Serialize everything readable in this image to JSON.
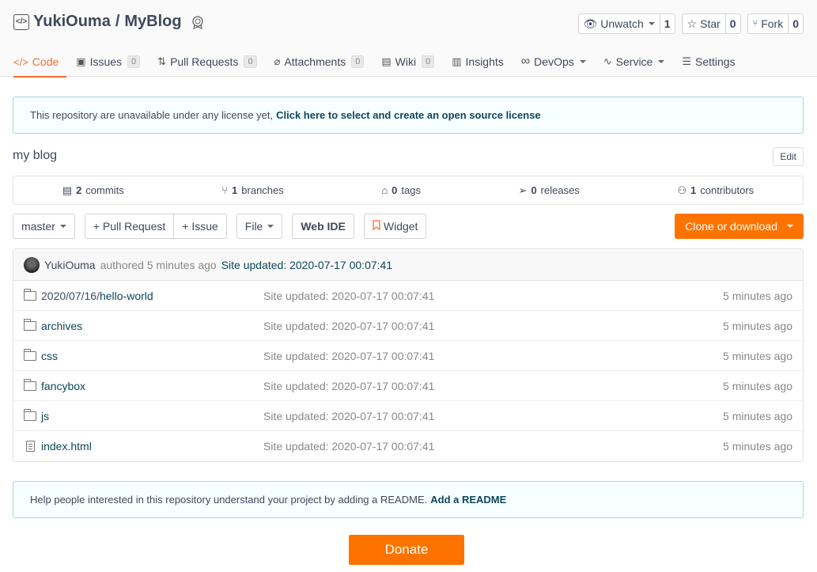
{
  "repo": {
    "owner": "YukiOuma",
    "separator": "/",
    "name": "MyBlog"
  },
  "actions": {
    "watch": {
      "label": "Unwatch",
      "count": "1"
    },
    "star": {
      "label": "Star",
      "count": "0"
    },
    "fork": {
      "label": "Fork",
      "count": "0"
    }
  },
  "tabs": [
    {
      "label": "Code",
      "icon": "code-icon"
    },
    {
      "label": "Issues",
      "count": "0",
      "icon": "issues-icon"
    },
    {
      "label": "Pull Requests",
      "count": "0",
      "icon": "pull-request-icon"
    },
    {
      "label": "Attachments",
      "count": "0",
      "icon": "paperclip-icon"
    },
    {
      "label": "Wiki",
      "count": "0",
      "icon": "wiki-icon"
    },
    {
      "label": "Insights",
      "icon": "bar-chart-icon"
    },
    {
      "label": "DevOps",
      "icon": "infinity-icon"
    },
    {
      "label": "Service",
      "icon": "pulse-icon"
    },
    {
      "label": "Settings",
      "icon": "settings-icon"
    }
  ],
  "license_notice": {
    "text": "This repository are unavailable under any license yet,",
    "link": "Click here to select and create an open source license"
  },
  "description": "my blog",
  "edit_label": "Edit",
  "stats": {
    "commits": {
      "count": "2",
      "label": "commits"
    },
    "branches": {
      "count": "1",
      "label": "branches"
    },
    "tags": {
      "count": "0",
      "label": "tags"
    },
    "releases": {
      "count": "0",
      "label": "releases"
    },
    "contributors": {
      "count": "1",
      "label": "contributors"
    }
  },
  "toolbar": {
    "branch": "master",
    "pull_request": "+ Pull Request",
    "issue": "+ Issue",
    "file": "File",
    "web_ide": "Web IDE",
    "widget": "Widget",
    "clone": "Clone or download"
  },
  "latest_commit": {
    "author": "YukiOuma",
    "meta": "authored 5 minutes ago",
    "message": "Site updated: 2020-07-17 00:07:41"
  },
  "files": [
    {
      "prefix": "2020/07/16/",
      "name": "hello-world",
      "type": "folder",
      "commit": "Site updated: 2020-07-17 00:07:41",
      "time": "5 minutes ago"
    },
    {
      "prefix": "",
      "name": "archives",
      "type": "folder",
      "commit": "Site updated: 2020-07-17 00:07:41",
      "time": "5 minutes ago"
    },
    {
      "prefix": "",
      "name": "css",
      "type": "folder",
      "commit": "Site updated: 2020-07-17 00:07:41",
      "time": "5 minutes ago"
    },
    {
      "prefix": "",
      "name": "fancybox",
      "type": "folder",
      "commit": "Site updated: 2020-07-17 00:07:41",
      "time": "5 minutes ago"
    },
    {
      "prefix": "",
      "name": "js",
      "type": "folder",
      "commit": "Site updated: 2020-07-17 00:07:41",
      "time": "5 minutes ago"
    },
    {
      "prefix": "",
      "name": "index.html",
      "type": "file",
      "commit": "Site updated: 2020-07-17 00:07:41",
      "time": "5 minutes ago"
    }
  ],
  "readme_notice": {
    "text": "Help people interested in this repository understand your project by adding a README.",
    "link": "Add a README"
  },
  "donate_label": "Donate",
  "colors": {
    "accent": "#fe7300",
    "link": "#0d4759",
    "notice_border": "#a9d5de"
  }
}
